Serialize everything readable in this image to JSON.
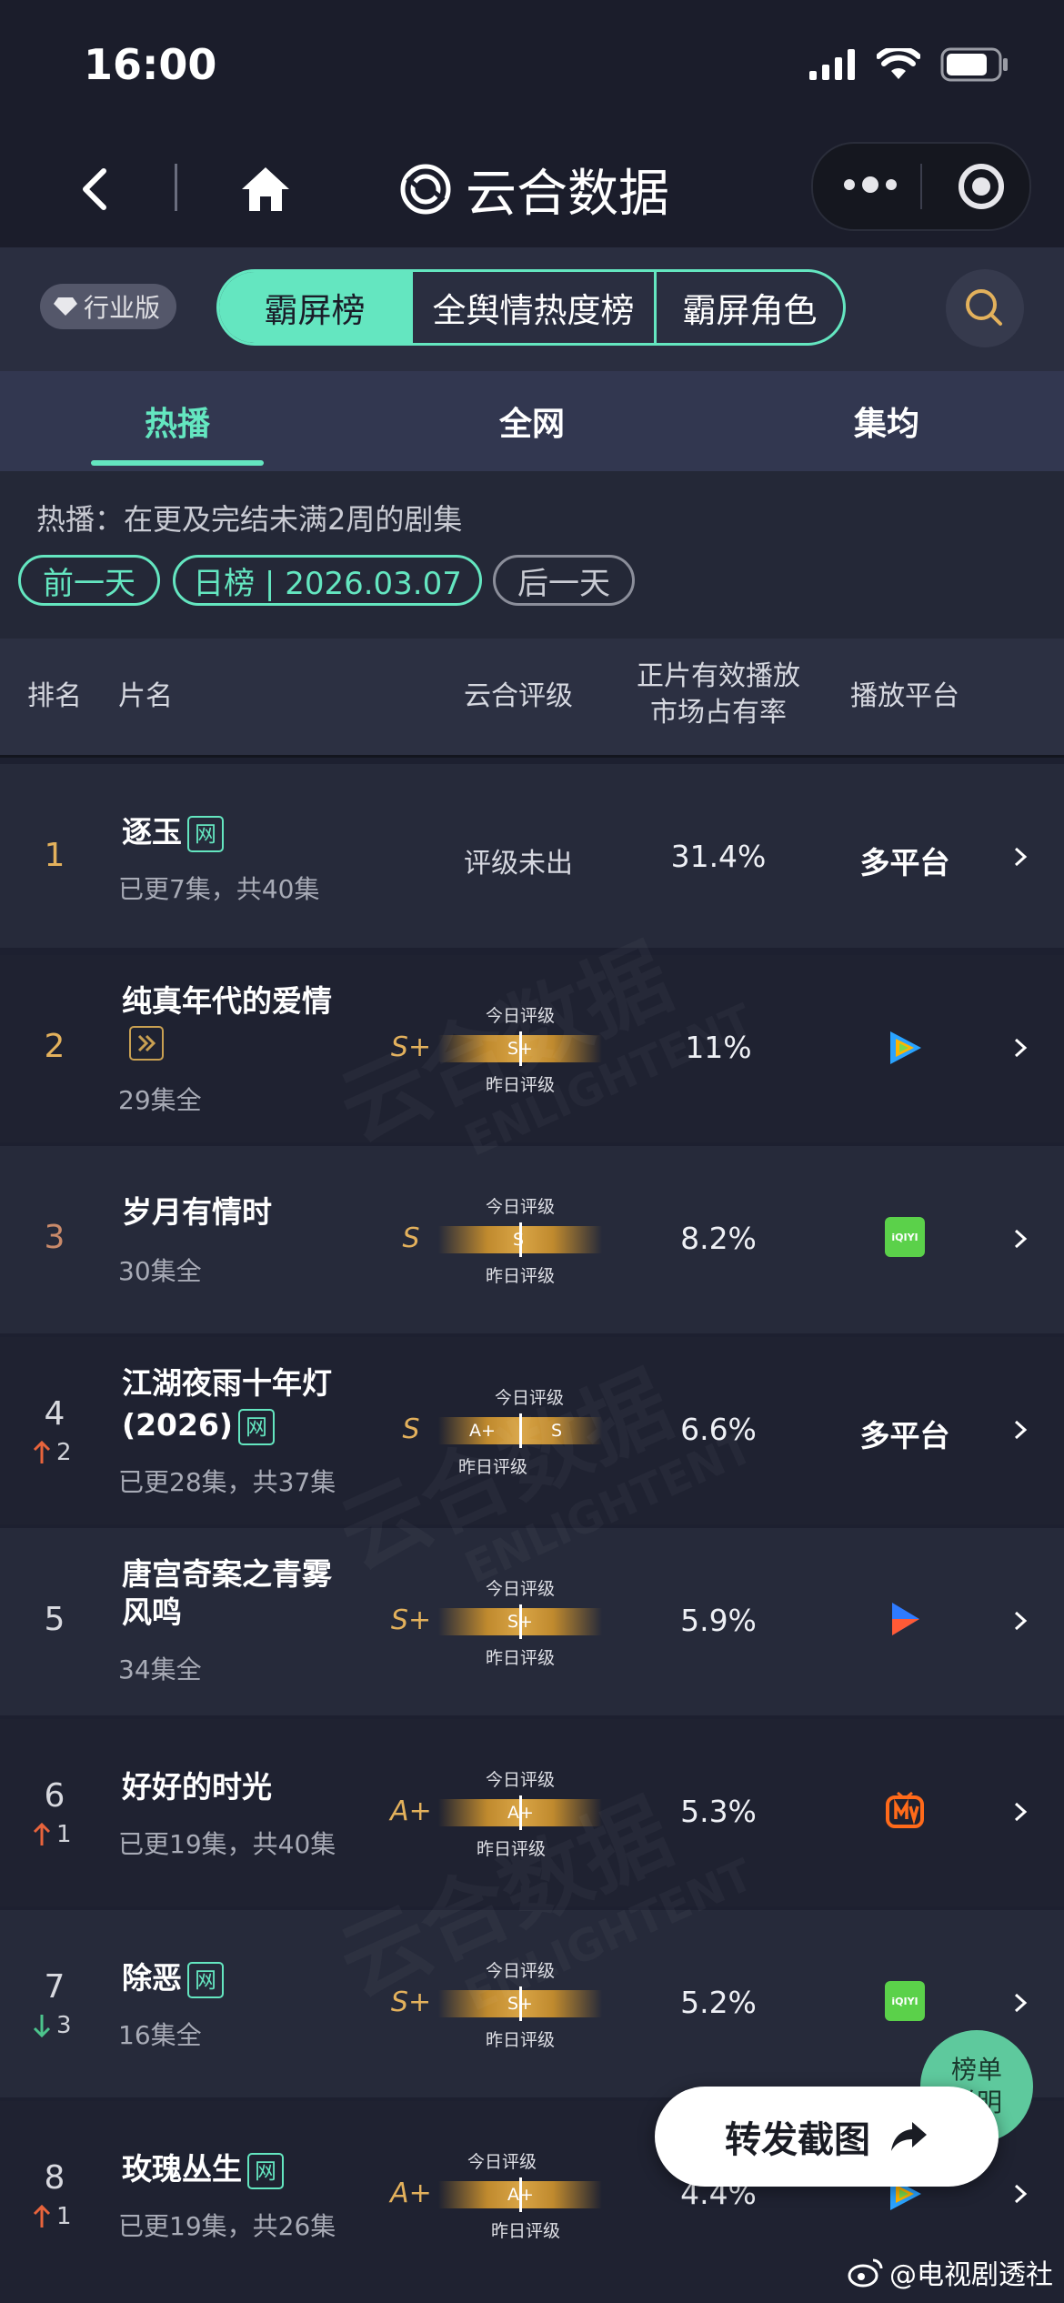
{
  "status": {
    "time": "16:00"
  },
  "nav": {
    "title": "云合数据"
  },
  "edition_badge": "行业版",
  "segments": [
    "霸屏榜",
    "全舆情热度榜",
    "霸屏角色"
  ],
  "tabs": [
    "热播",
    "全网",
    "集均"
  ],
  "info": {
    "description": "热播：在更及完结未满2周的剧集",
    "prev_day": "前一天",
    "date_label": "日榜 | 2026.03.07",
    "next_day": "后一天"
  },
  "table_headers": {
    "rank": "排名",
    "title": "片名",
    "rating": "云合评级",
    "share_line1": "正片有效播放",
    "share_line2": "市场占有率",
    "platform": "播放平台"
  },
  "gauge_labels": {
    "today": "今日评级",
    "yesterday": "昨日评级"
  },
  "rows": [
    {
      "rank": "1",
      "title": "逐玉",
      "tag": "网",
      "sub": "已更7集，共40集",
      "rating_text": "评级未出",
      "share": "31.4%",
      "platform": "多平台"
    },
    {
      "rank": "2",
      "title": "纯真年代的爱情",
      "sub": "29集全",
      "grade": "S+",
      "gauge_text": "S+",
      "share": "11%",
      "platform_icon": "tencent-video-icon"
    },
    {
      "rank": "3",
      "title": "岁月有情时",
      "sub": "30集全",
      "grade": "S",
      "gauge_text": "S",
      "share": "8.2%",
      "platform_icon": "iqiyi-icon"
    },
    {
      "rank": "4",
      "move": "2",
      "move_dir": "up",
      "title_line1": "江湖夜雨十年灯",
      "title_line2": "(2026)",
      "tag": "网",
      "sub": "已更28集，共37集",
      "grade": "S",
      "gauge_left": "A+",
      "gauge_right": "S",
      "share": "6.6%",
      "platform": "多平台"
    },
    {
      "rank": "5",
      "title_line1": "唐宫奇案之青雾",
      "title_line2": "风鸣",
      "sub": "34集全",
      "grade": "S+",
      "gauge_text": "S+",
      "share": "5.9%",
      "platform_icon": "youku-icon"
    },
    {
      "rank": "6",
      "move": "1",
      "move_dir": "up",
      "title": "好好的时光",
      "sub": "已更19集，共40集",
      "grade": "A+",
      "gauge_text": "A+",
      "share": "5.3%",
      "platform_icon": "mango-tv-icon"
    },
    {
      "rank": "7",
      "move": "3",
      "move_dir": "down",
      "title": "除恶",
      "tag": "网",
      "sub": "16集全",
      "grade": "S+",
      "gauge_text": "S+",
      "share": "5.2%",
      "platform_icon": "iqiyi-icon"
    },
    {
      "rank": "8",
      "move": "1",
      "move_dir": "up",
      "title": "玫瑰丛生",
      "tag": "网",
      "sub": "已更19集，共26集",
      "grade": "A+",
      "gauge_text": "A+",
      "share": "4.4%",
      "platform_icon": "tencent-video-icon"
    }
  ],
  "fab": {
    "legend_line1": "榜单",
    "legend_line2": "说明",
    "share": "转发截图"
  },
  "credit": "@电视剧透社",
  "watermark": {
    "cn": "云合数据",
    "en": "ENLIGHTENT"
  },
  "platform_icon_text": {
    "iqiyi": "iQIYI"
  },
  "colors": {
    "accent": "#64e6c0",
    "gold": "#e3b15c",
    "up": "#e8643c",
    "down": "#4cc48c"
  }
}
